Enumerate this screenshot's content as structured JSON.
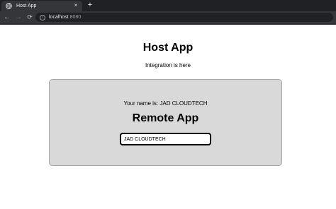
{
  "browser": {
    "tab": {
      "title": "Host App",
      "favicon": "globe-icon",
      "close": "×"
    },
    "new_tab": "+",
    "nav": {
      "back": "←",
      "forward": "→",
      "reload": "⟳"
    },
    "address": {
      "host": "localhost",
      "port": ":8080",
      "info": "i"
    }
  },
  "page": {
    "title": "Host App",
    "subtitle": "Integration is here",
    "remote": {
      "name_line": "Your name is: JAD CLOUDTECH",
      "title": "Remote App",
      "input_value": "JAD CLOUDTECH"
    }
  },
  "colors": {
    "browser_frame": "#202124",
    "toolbar": "#35363a",
    "card_bg": "#d9d9d9",
    "page_bg": "#ffffff"
  }
}
